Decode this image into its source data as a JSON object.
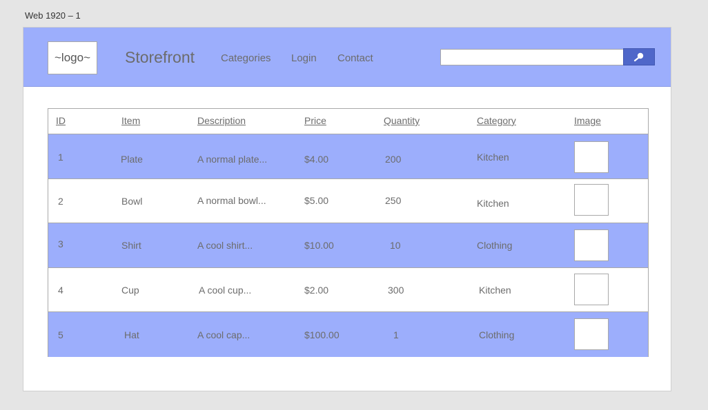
{
  "artboard_label": "Web 1920 – 1",
  "header": {
    "logo": "~logo~",
    "brand": "Storefront",
    "nav": [
      "Categories",
      "Login",
      "Contact"
    ],
    "search": {
      "value": "",
      "placeholder": ""
    },
    "search_icon": "search-icon"
  },
  "colors": {
    "header_bg": "#9caefc",
    "row_highlight": "#9caefc",
    "search_button": "#4f67c9"
  },
  "table": {
    "columns": [
      "ID",
      "Item",
      "Description",
      "Price",
      "Quantity",
      "Category",
      "Image"
    ],
    "rows": [
      [
        "1",
        "Plate",
        "A normal plate...",
        "$4.00",
        "200",
        "Kitchen"
      ],
      [
        "2",
        "Bowl",
        "A normal bowl...",
        "$5.00",
        "250",
        "Kitchen"
      ],
      [
        "3",
        "Shirt",
        "A cool shirt...",
        "$10.00",
        "10",
        "Clothing"
      ],
      [
        "4",
        "Cup",
        "A cool cup...",
        "$2.00",
        "300",
        "Kitchen"
      ],
      [
        "5",
        "Hat",
        "A cool cap...",
        "$100.00",
        "1",
        "Clothing"
      ]
    ]
  }
}
